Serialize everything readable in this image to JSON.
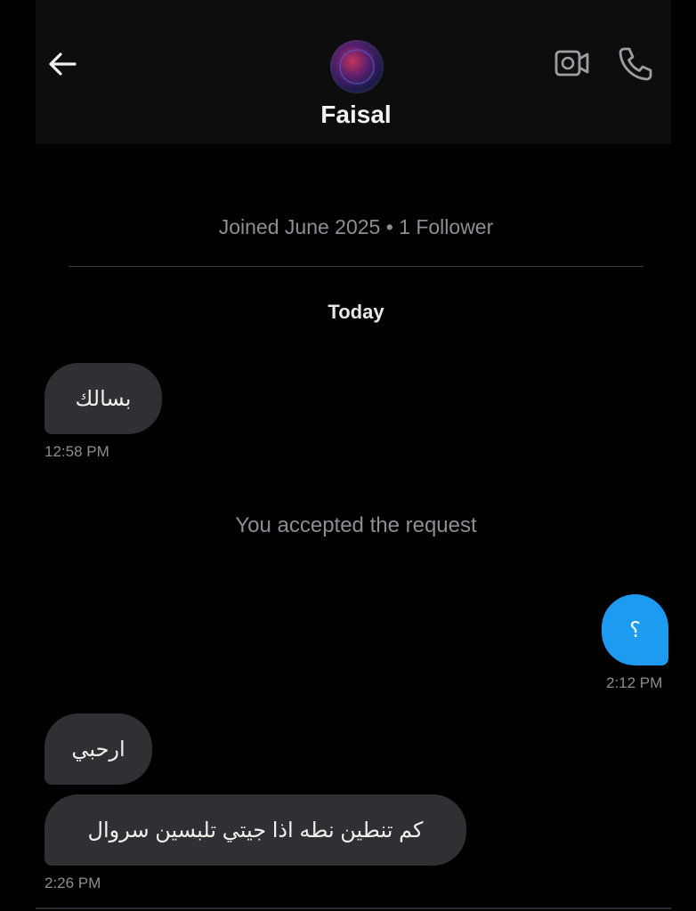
{
  "header": {
    "contact_name": "Faisal",
    "back_icon": "arrow-left-icon",
    "video_icon": "video-camera-icon",
    "call_icon": "phone-icon"
  },
  "profile_meta": "Joined June 2025 • 1 Follower",
  "date_separator": "Today",
  "messages": [
    {
      "direction": "incoming",
      "text": "بسالك",
      "time": "12:58 PM"
    },
    {
      "direction": "system",
      "text": "You accepted the request"
    },
    {
      "direction": "outgoing",
      "text": "؟",
      "time": "2:12 PM"
    },
    {
      "direction": "incoming",
      "text": "ارحبي"
    },
    {
      "direction": "incoming",
      "text": "كم تنطين نطه اذا جيتي تلبسين سروال",
      "time": "2:26 PM"
    }
  ],
  "colors": {
    "background": "#000000",
    "header_background": "#0d0d0e",
    "incoming_bubble": "#2f3033",
    "outgoing_bubble": "#1d9bf0",
    "muted_text": "#8b8f94"
  }
}
